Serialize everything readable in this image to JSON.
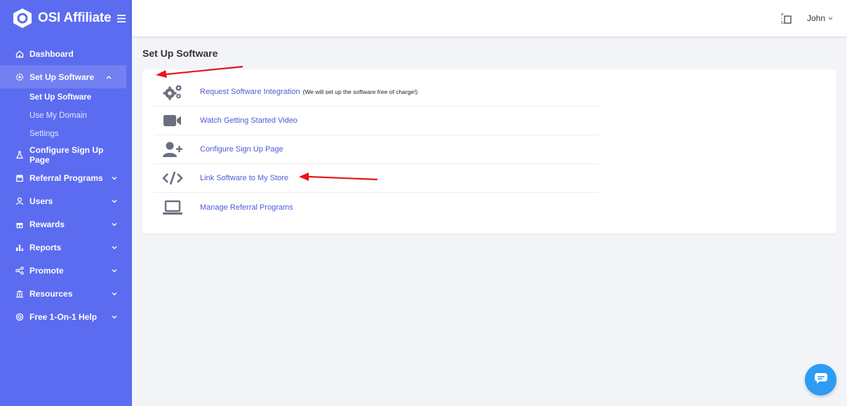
{
  "app": {
    "brand_name": "OSI Affiliate"
  },
  "sidebar": {
    "items": [
      {
        "label": "Dashboard",
        "icon": "home-icon"
      },
      {
        "label": "Set Up Software",
        "icon": "gear-icon",
        "expanded": true,
        "children": [
          {
            "label": "Set Up Software",
            "current": true
          },
          {
            "label": "Use My Domain"
          },
          {
            "label": "Settings"
          }
        ]
      },
      {
        "label": "Configure Sign Up Page",
        "icon": "flask-icon"
      },
      {
        "label": "Referral Programs",
        "icon": "store-icon"
      },
      {
        "label": "Users",
        "icon": "user-icon"
      },
      {
        "label": "Rewards",
        "icon": "gift-icon"
      },
      {
        "label": "Reports",
        "icon": "bar-chart-icon"
      },
      {
        "label": "Promote",
        "icon": "share-icon"
      },
      {
        "label": "Resources",
        "icon": "bank-icon"
      },
      {
        "label": "Free 1-On-1 Help",
        "icon": "lifebuoy-icon"
      }
    ]
  },
  "topbar": {
    "user_name": "John"
  },
  "main": {
    "title": "Set Up Software",
    "rows": [
      {
        "link": "Request Software Integration",
        "note": "(We will set up the software free of charge!)",
        "icon": "gears-icon"
      },
      {
        "link": "Watch Getting Started Video",
        "icon": "video-camera-icon"
      },
      {
        "link": "Configure Sign Up Page",
        "icon": "user-plus-icon"
      },
      {
        "link": "Link Software to My Store",
        "icon": "code-icon"
      },
      {
        "link": "Manage Referral Programs",
        "icon": "laptop-icon"
      }
    ]
  },
  "colors": {
    "sidebar": "#5b6cf0",
    "link": "#4f5bd5",
    "annotation_arrow": "#e8141b",
    "chat": "#2d9cf4"
  }
}
